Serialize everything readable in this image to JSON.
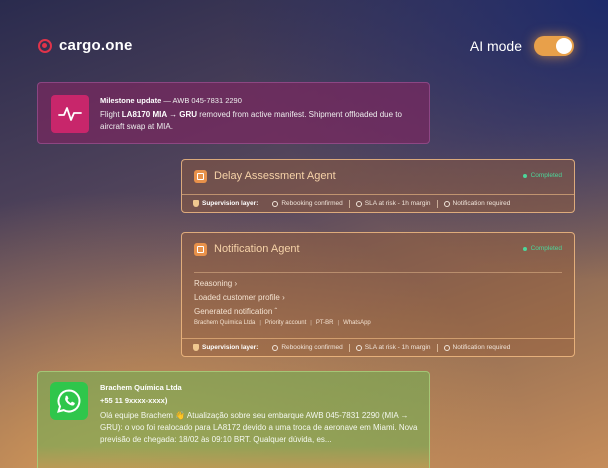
{
  "brand": {
    "name": "cargo.one"
  },
  "ai_mode": {
    "label": "AI mode",
    "enabled": true
  },
  "milestone": {
    "title": "Milestone update",
    "awb": "— AWB 045-7831 2290",
    "text_pre": "Flight ",
    "flight": "LA8170 MIA → GRU",
    "text_post": " removed from active manifest. Shipment offloaded due to aircraft swap at MIA.",
    "icon": "pulse-icon",
    "color": "#c8266b"
  },
  "supervision": {
    "label": "Supervision layer:",
    "items": [
      "Rebooking confirmed",
      "SLA at risk - 1h margin",
      "Notification required"
    ]
  },
  "agents": [
    {
      "title": "Delay Assessment Agent",
      "status": "Completed"
    },
    {
      "title": "Notification Agent",
      "status": "Completed",
      "rows": [
        "Reasoning",
        "Loaded customer profile",
        "Generated notification"
      ],
      "tags": [
        "Brachem Química Ltda",
        "Priority account",
        "PT-BR",
        "WhatsApp"
      ]
    }
  ],
  "whatsapp": {
    "name": "Brachem Química Ltda",
    "phone": "+55 11 9xxxx-xxxx)",
    "message": "Olá equipe Brachem 👋 Atualização sobre seu embarque AWB 045-7831 2290 (MIA → GRU): o voo foi realocado para LA8172 devido a uma troca de aeronave em Miami. Nova previsão de chegada: 18/02 às 09:10 BRT. Qualquer dúvida, es...",
    "icon": "whatsapp-icon"
  },
  "colors": {
    "accent": "#e8a04a",
    "status_green": "#4cd69a",
    "brand_red": "#e0334a"
  }
}
